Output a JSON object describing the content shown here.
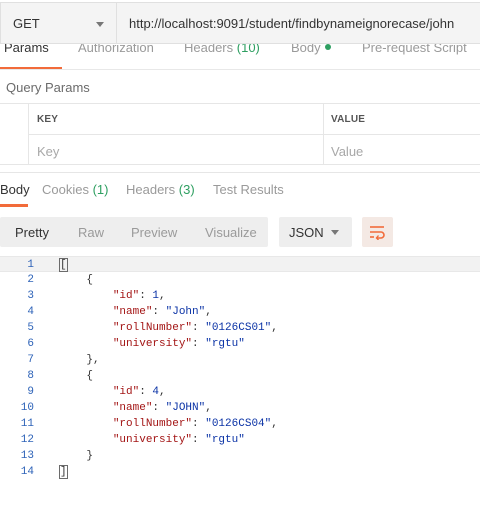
{
  "request": {
    "method": "GET",
    "url": "http://localhost:9091/student/findbynameignorecase/john"
  },
  "request_tabs": [
    {
      "label": "Params",
      "count": ""
    },
    {
      "label": "Authorization",
      "count": ""
    },
    {
      "label": "Headers",
      "count": "(10)"
    },
    {
      "label": "Body",
      "count": ""
    },
    {
      "label": "Pre-request Script",
      "count": ""
    }
  ],
  "query_params": {
    "title": "Query Params",
    "columns": [
      "KEY",
      "VALUE"
    ],
    "key_placeholder": "Key",
    "value_placeholder": "Value"
  },
  "response_tabs": [
    {
      "label": "Body",
      "count": ""
    },
    {
      "label": "Cookies",
      "count": "(1)"
    },
    {
      "label": "Headers",
      "count": "(3)"
    },
    {
      "label": "Test Results",
      "count": ""
    }
  ],
  "format_modes": [
    "Pretty",
    "Raw",
    "Preview",
    "Visualize"
  ],
  "format_select": "JSON",
  "icons": {
    "wrap": "wrap-lines-icon",
    "method_caret": "chevron-down-icon",
    "format_caret": "chevron-down-icon"
  },
  "colors": {
    "accent": "#f26b3a",
    "count_green": "#2e9f61",
    "line_number": "#2e63b8",
    "json_key": "#a31515",
    "json_value": "#0b33a6"
  },
  "code_lines": [
    {
      "n": "1",
      "indent": "",
      "t": "["
    },
    {
      "n": "2",
      "indent": "    ",
      "t": "{"
    },
    {
      "n": "3",
      "indent": "        ",
      "k": "\"id\"",
      "v": "1",
      "vt": "n",
      "tail": ","
    },
    {
      "n": "4",
      "indent": "        ",
      "k": "\"name\"",
      "v": "\"John\"",
      "vt": "s",
      "tail": ","
    },
    {
      "n": "5",
      "indent": "        ",
      "k": "\"rollNumber\"",
      "v": "\"0126CS01\"",
      "vt": "s",
      "tail": ","
    },
    {
      "n": "6",
      "indent": "        ",
      "k": "\"university\"",
      "v": "\"rgtu\"",
      "vt": "s",
      "tail": ""
    },
    {
      "n": "7",
      "indent": "    ",
      "t": "},"
    },
    {
      "n": "8",
      "indent": "    ",
      "t": "{"
    },
    {
      "n": "9",
      "indent": "        ",
      "k": "\"id\"",
      "v": "4",
      "vt": "n",
      "tail": ","
    },
    {
      "n": "10",
      "indent": "        ",
      "k": "\"name\"",
      "v": "\"JOHN\"",
      "vt": "s",
      "tail": ","
    },
    {
      "n": "11",
      "indent": "        ",
      "k": "\"rollNumber\"",
      "v": "\"0126CS04\"",
      "vt": "s",
      "tail": ","
    },
    {
      "n": "12",
      "indent": "        ",
      "k": "\"university\"",
      "v": "\"rgtu\"",
      "vt": "s",
      "tail": ""
    },
    {
      "n": "13",
      "indent": "    ",
      "t": "}"
    },
    {
      "n": "14",
      "indent": "",
      "t": "]"
    }
  ]
}
